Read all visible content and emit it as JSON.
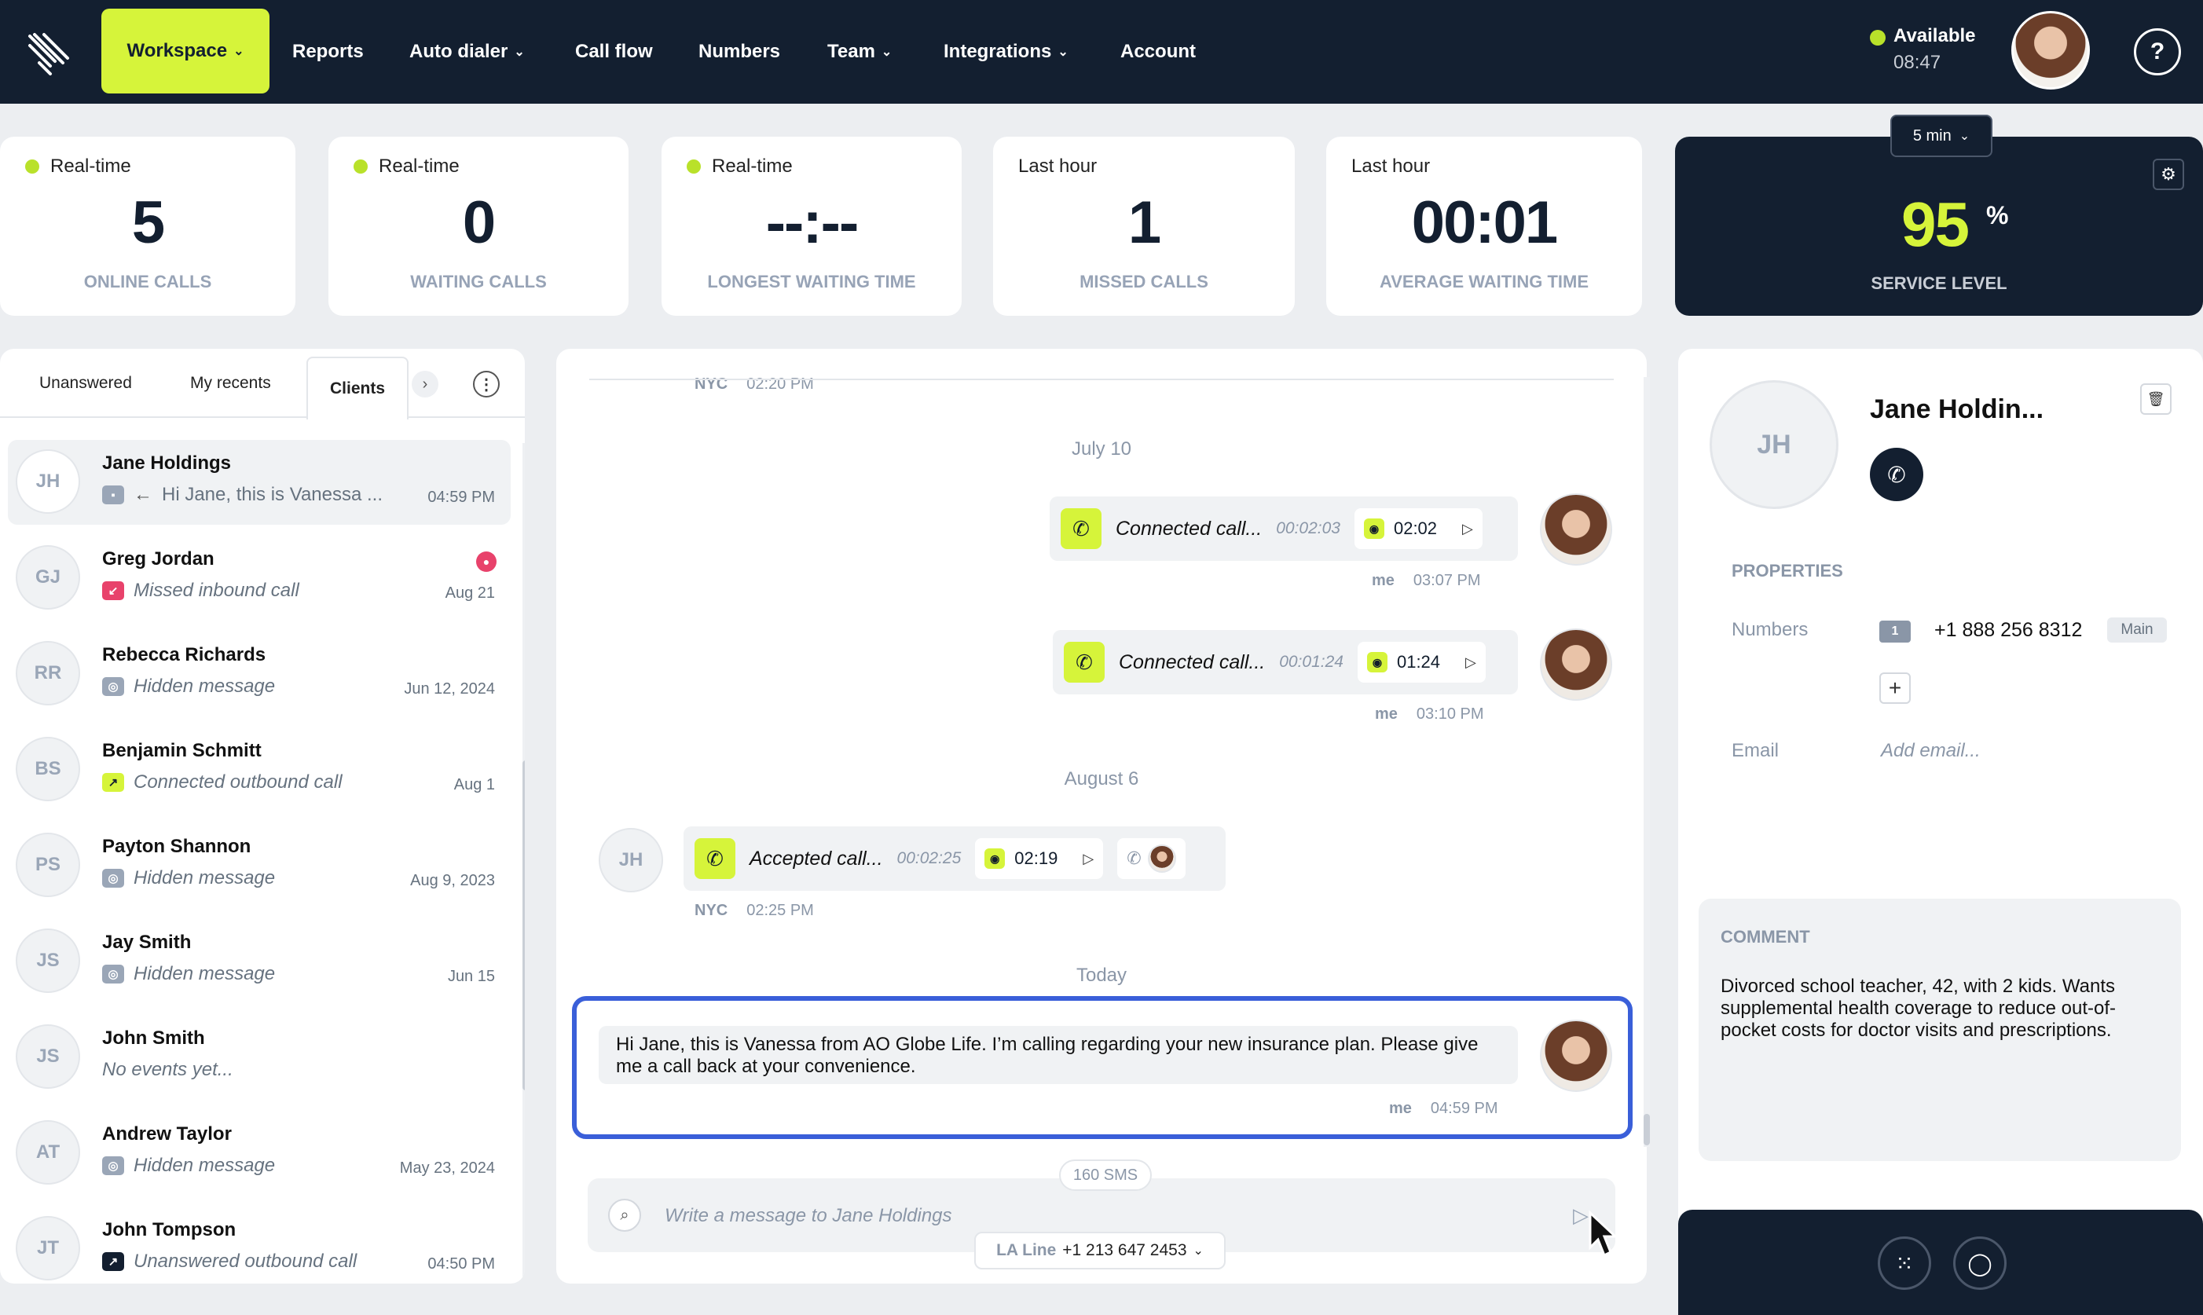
{
  "nav": {
    "items": [
      {
        "label": "Workspace",
        "dropdown": true
      },
      {
        "label": "Reports",
        "dropdown": false
      },
      {
        "label": "Auto dialer",
        "dropdown": true
      },
      {
        "label": "Call flow",
        "dropdown": false
      },
      {
        "label": "Numbers",
        "dropdown": false
      },
      {
        "label": "Team",
        "dropdown": true
      },
      {
        "label": "Integrations",
        "dropdown": true
      },
      {
        "label": "Account",
        "dropdown": false
      }
    ],
    "status": "Available",
    "status_time": "08:47",
    "help_icon": "help-icon",
    "accent": "#d6f43a",
    "bg": "#131f30"
  },
  "stats": [
    {
      "period": "Real-time",
      "value": "5",
      "caption": "ONLINE CALLS"
    },
    {
      "period": "Real-time",
      "value": "0",
      "caption": "WAITING CALLS"
    },
    {
      "period": "Real-time",
      "value": "--:--",
      "caption": "LONGEST WAITING TIME"
    },
    {
      "period": "Last hour",
      "value": "1",
      "caption": "MISSED CALLS"
    },
    {
      "period": "Last hour",
      "value": "00:01",
      "caption": "AVERAGE WAITING TIME"
    }
  ],
  "service": {
    "interval": "5 min",
    "value": "95",
    "unit": "%",
    "caption": "SERVICE LEVEL"
  },
  "left": {
    "tabs": [
      "Unanswered",
      "My recents",
      "Clients"
    ],
    "active_tab": "Clients",
    "contacts": [
      {
        "initials": "JH",
        "name": "Jane Holdings",
        "preview": "Hi Jane, this is Vanessa ...",
        "date": "04:59 PM",
        "type": "sms"
      },
      {
        "initials": "GJ",
        "name": "Greg Jordan",
        "preview": "Missed inbound call",
        "date": "Aug 21",
        "type": "missed"
      },
      {
        "initials": "RR",
        "name": "Rebecca Richards",
        "preview": "Hidden message",
        "date": "Jun 12, 2024",
        "type": "hidden"
      },
      {
        "initials": "BS",
        "name": "Benjamin Schmitt",
        "preview": "Connected outbound call",
        "date": "Aug 1",
        "type": "outbound"
      },
      {
        "initials": "PS",
        "name": "Payton Shannon",
        "preview": "Hidden message",
        "date": "Aug 9, 2023",
        "type": "hidden"
      },
      {
        "initials": "JS",
        "name": "Jay Smith",
        "preview": "Hidden message",
        "date": "Jun 15",
        "type": "hidden"
      },
      {
        "initials": "JS",
        "name": "John Smith",
        "preview": "No events yet...",
        "date": "",
        "type": "none"
      },
      {
        "initials": "AT",
        "name": "Andrew Taylor",
        "preview": "Hidden message",
        "date": "May 23, 2024",
        "type": "hidden"
      },
      {
        "initials": "JT",
        "name": "John Tompson",
        "preview": "Unanswered outbound call",
        "date": "04:50 PM",
        "type": "unanswered"
      }
    ]
  },
  "chat": {
    "top_meta": {
      "loc": "NYC",
      "time": "02:20 PM"
    },
    "date1": "July 10",
    "call1": {
      "label": "Connected call...",
      "duration": "00:02:03",
      "rec": "02:02",
      "who": "me",
      "time": "03:07 PM"
    },
    "call2": {
      "label": "Connected call...",
      "duration": "00:01:24",
      "rec": "01:24",
      "who": "me",
      "time": "03:10 PM"
    },
    "date2": "August 6",
    "call3": {
      "initials": "JH",
      "label": "Accepted call...",
      "duration": "00:02:25",
      "rec": "02:19",
      "loc": "NYC",
      "time": "02:25 PM"
    },
    "date3": "Today",
    "sms": {
      "text": "Hi Jane, this is Vanessa from AO Globe Life. I’m calling regarding your new insurance plan. Please give me a call back at your convenience.",
      "who": "me",
      "time": "04:59 PM"
    },
    "counter": "160 SMS",
    "placeholder": "Write a message to Jane Holdings",
    "line_name": "LA Line",
    "line_number": "+1 213 647 2453"
  },
  "contact": {
    "initials": "JH",
    "name": "Jane Holdin...",
    "properties_label": "PROPERTIES",
    "numbers_label": "Numbers",
    "number_flag": "1",
    "number": "+1 888 256 8312",
    "number_tag": "Main",
    "email_label": "Email",
    "email_placeholder": "Add email...",
    "comment_label": "COMMENT",
    "comment": "Divorced school teacher, 42, with 2 kids. Wants supplemental health coverage to reduce out-of-pocket costs for doctor visits and prescriptions."
  }
}
